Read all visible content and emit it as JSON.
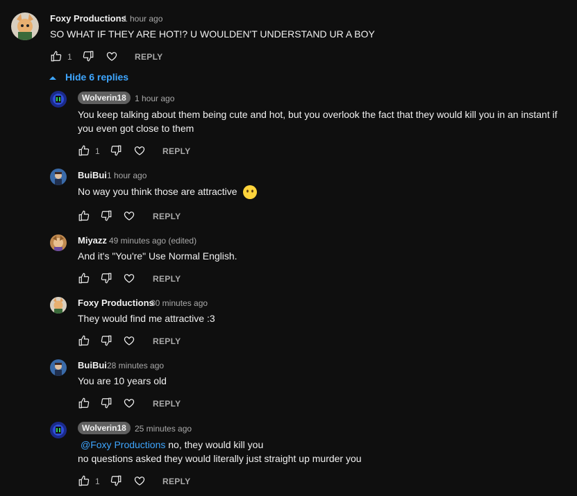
{
  "top_comment": {
    "author": "Foxy Productions",
    "time": "1 hour ago",
    "text": "SO WHAT IF THEY ARE HOT!? U WOULDEN'T UNDERSTAND UR A BOY",
    "likes": "1",
    "reply_label": "REPLY"
  },
  "hide_replies_label": "Hide 6 replies",
  "replies": [
    {
      "author": "Wolverin18",
      "time": "1 hour ago",
      "text_lines": [
        "You keep talking about them being cute and hot, but you overlook the fact that they would kill you in an instant if",
        "you even got close to them"
      ],
      "likes": "1",
      "reply_label": "REPLY"
    },
    {
      "author": "BuiBui",
      "time": "1 hour ago",
      "text": "No way you think those are attractive",
      "emoji": "no-mouth-face-emoji",
      "reply_label": "REPLY"
    },
    {
      "author": "Miyazz",
      "time": "49 minutes ago (edited)",
      "text": "And it's \"You're\" Use Normal English.",
      "reply_label": "REPLY"
    },
    {
      "author": "Foxy Productions",
      "time": "30 minutes ago",
      "text": "They would find me attractive :3",
      "reply_label": "REPLY"
    },
    {
      "author": "BuiBui",
      "time": "28 minutes ago",
      "text": "You are 10 years old",
      "reply_label": "REPLY"
    },
    {
      "author": "Wolverin18",
      "time": "25 minutes ago",
      "mention": "@Foxy Productions",
      "text_line1": " no, they would kill you",
      "text_line2": "no questions asked they would literally just straight up murder you",
      "likes": "1",
      "reply_label": "REPLY"
    }
  ],
  "colors": {
    "background": "#0f0f0f",
    "link_blue": "#3ea6ff",
    "secondary_text": "#aaaaaa",
    "pill_bg": "#606060"
  }
}
